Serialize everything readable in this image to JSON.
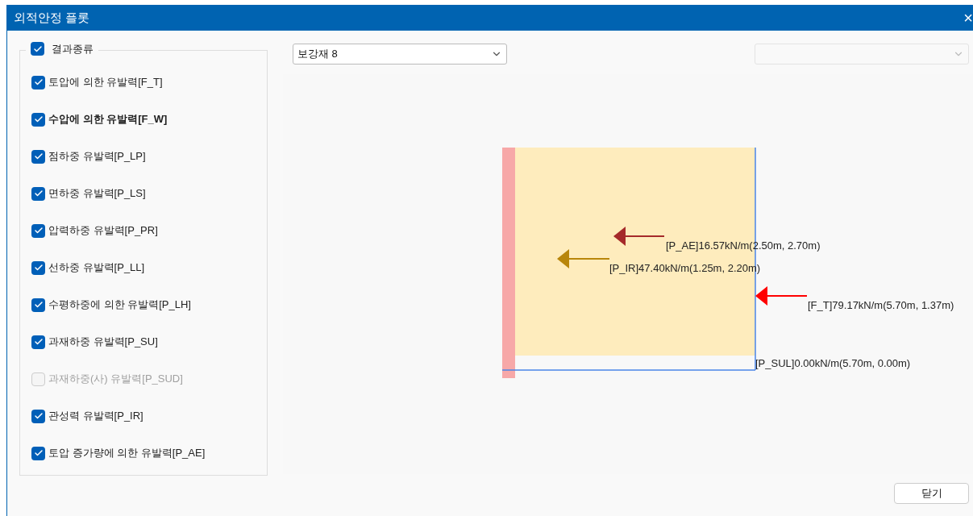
{
  "window": {
    "title": "외적안정 플롯",
    "close": "×"
  },
  "group": {
    "label": "결과종류",
    "checked": true
  },
  "items": [
    {
      "label": "토압에 의한 유발력[F_T]",
      "checked": true,
      "disabled": false,
      "focused": false
    },
    {
      "label": "수압에 의한 유발력[F_W]",
      "checked": true,
      "disabled": false,
      "focused": true
    },
    {
      "label": "점하중 유발력[P_LP]",
      "checked": true,
      "disabled": false,
      "focused": false
    },
    {
      "label": "면하중 유발력[P_LS]",
      "checked": true,
      "disabled": false,
      "focused": false
    },
    {
      "label": "압력하중 유발력[P_PR]",
      "checked": true,
      "disabled": false,
      "focused": false
    },
    {
      "label": "선하중 유발력[P_LL]",
      "checked": true,
      "disabled": false,
      "focused": false
    },
    {
      "label": "수평하중에 의한 유발력[P_LH]",
      "checked": true,
      "disabled": false,
      "focused": false
    },
    {
      "label": "과재하중 유발력[P_SU]",
      "checked": true,
      "disabled": false,
      "focused": false
    },
    {
      "label": "과재하중(사) 유발력[P_SUD]",
      "checked": false,
      "disabled": true,
      "focused": false
    },
    {
      "label": "관성력 유발력[P_IR]",
      "checked": true,
      "disabled": false,
      "focused": false
    },
    {
      "label": "토압 증가량에 의한 유발력[P_AE]",
      "checked": true,
      "disabled": false,
      "focused": false
    }
  ],
  "dropdowns": [
    {
      "value": "보강재 8",
      "disabled": false
    },
    {
      "disabled": true
    }
  ],
  "plot": {
    "forces": [
      {
        "label": "[P_AE]16.57kN/m(2.50m, 2.70m)",
        "color": "#a52a2a",
        "kind": "arrow"
      },
      {
        "label": "[P_IR]47.40kN/m(1.25m, 2.20m)",
        "color": "#b8860b",
        "kind": "arrow"
      },
      {
        "label": "[F_T]79.17kN/m(5.70m, 1.37m)",
        "color": "#ff0000",
        "kind": "arrow"
      },
      {
        "label": "[P_SUL]0.00kN/m(5.70m, 0.00m)",
        "kind": "text"
      }
    ]
  },
  "buttons": [
    "닫기"
  ]
}
